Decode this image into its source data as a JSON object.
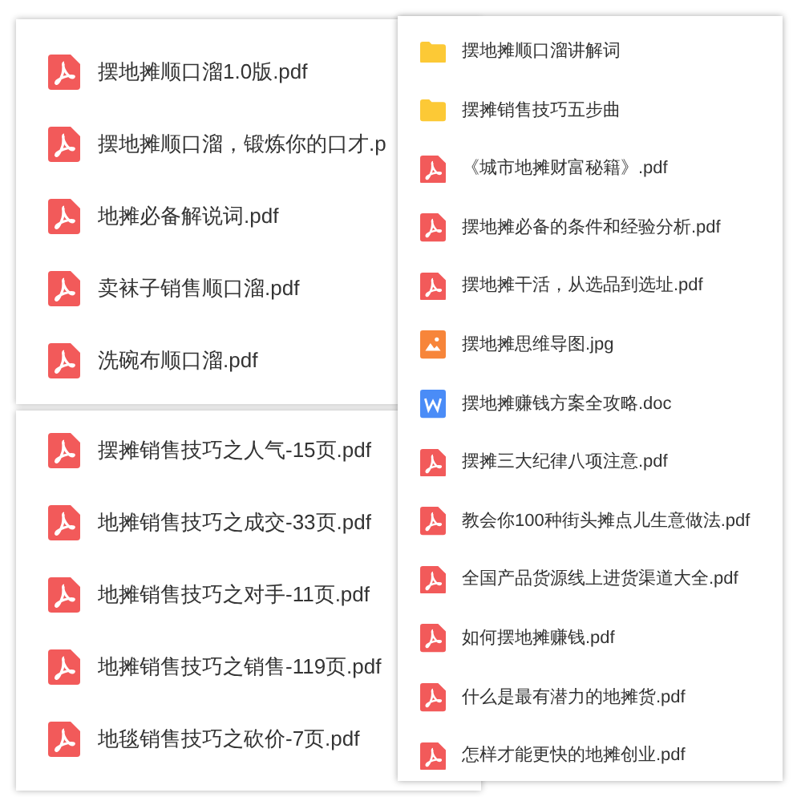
{
  "left_panel": {
    "files": [
      {
        "name": "摆地摊顺口溜1.0版.pdf",
        "kind": "pdf"
      },
      {
        "name": "摆地摊顺口溜，锻炼你的口才.p",
        "kind": "pdf"
      },
      {
        "name": "地摊必备解说词.pdf",
        "kind": "pdf"
      },
      {
        "name": "卖袜子销售顺口溜.pdf",
        "kind": "pdf"
      },
      {
        "name": "洗碗布顺口溜.pdf",
        "kind": "pdf"
      }
    ]
  },
  "left_panel_2": {
    "files": [
      {
        "name": "摆摊销售技巧之人气-15页.pdf",
        "kind": "pdf"
      },
      {
        "name": "地摊销售技巧之成交-33页.pdf",
        "kind": "pdf"
      },
      {
        "name": "地摊销售技巧之对手-11页.pdf",
        "kind": "pdf"
      },
      {
        "name": "地摊销售技巧之销售-119页.pdf",
        "kind": "pdf"
      },
      {
        "name": "地毯销售技巧之砍价-7页.pdf",
        "kind": "pdf"
      }
    ]
  },
  "right_panel": {
    "files": [
      {
        "name": "摆地摊顺口溜讲解词",
        "kind": "folder"
      },
      {
        "name": "摆摊销售技巧五步曲",
        "kind": "folder"
      },
      {
        "name": "《城市地摊财富秘籍》.pdf",
        "kind": "pdf"
      },
      {
        "name": "摆地摊必备的条件和经验分析.pdf",
        "kind": "pdf"
      },
      {
        "name": "摆地摊干活，从选品到选址.pdf",
        "kind": "pdf"
      },
      {
        "name": "摆地摊思维导图.jpg",
        "kind": "image"
      },
      {
        "name": "摆地摊赚钱方案全攻略.doc",
        "kind": "doc"
      },
      {
        "name": "摆摊三大纪律八项注意.pdf",
        "kind": "pdf"
      },
      {
        "name": "教会你100种街头摊点儿生意做法.pdf",
        "kind": "pdf"
      },
      {
        "name": "全国产品货源线上进货渠道大全.pdf",
        "kind": "pdf"
      },
      {
        "name": "如何摆地摊赚钱.pdf",
        "kind": "pdf"
      },
      {
        "name": "什么是最有潜力的地摊货.pdf",
        "kind": "pdf"
      },
      {
        "name": "怎样才能更快的地摊创业.pdf",
        "kind": "pdf"
      }
    ]
  }
}
